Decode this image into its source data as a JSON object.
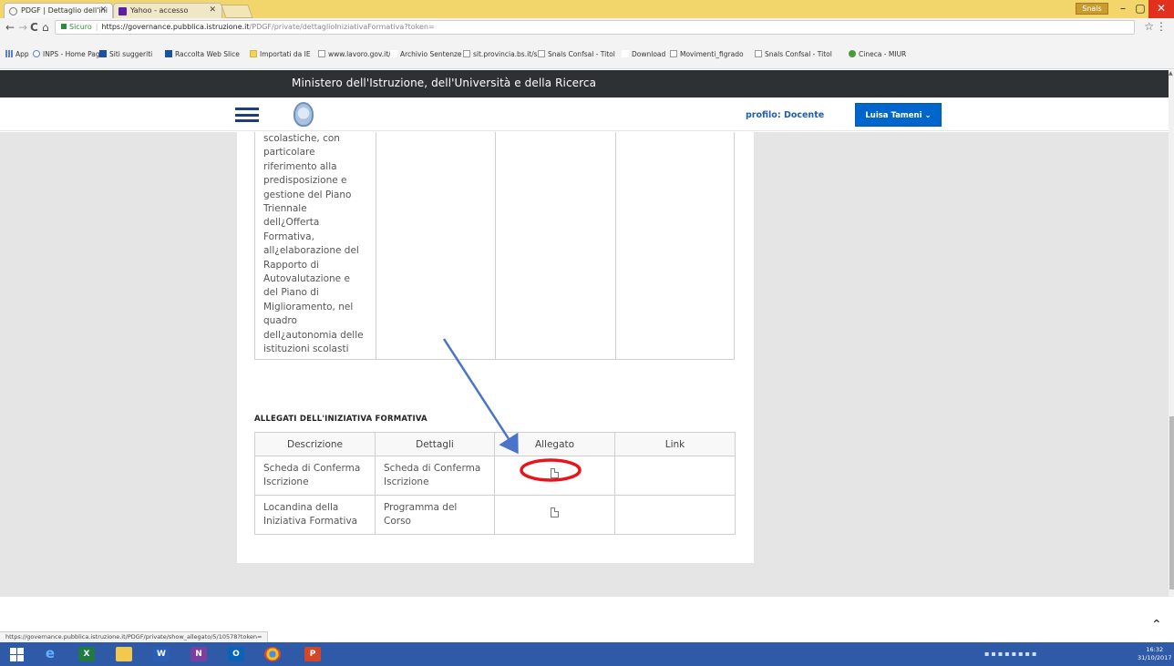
{
  "browser": {
    "tabs": [
      {
        "title": "PDGF | Dettaglio dell'ini"
      },
      {
        "title": "Yahoo - accesso"
      }
    ],
    "user_chip": "Snals",
    "window_controls": {
      "minimize": "–",
      "maximize": "▢",
      "close": "✕"
    },
    "nav": {
      "back": "←",
      "forward": "→",
      "reload": "C",
      "home": "⌂"
    },
    "address": {
      "secure_label": "Sicuro",
      "url_host": "https://governance.pubblica.istruzione.it",
      "url_path": "/PDGF/private/dettaglioIniziativaFormativa?token="
    },
    "bookmarks": [
      {
        "label": "App",
        "icon": "apps-grid-icon"
      },
      {
        "label": "INPS - Home Page",
        "icon": "inps-icon"
      },
      {
        "label": "Siti suggeriti",
        "icon": "bing-icon"
      },
      {
        "label": "Raccolta Web Slice",
        "icon": "bing-icon"
      },
      {
        "label": "Importati da IE",
        "icon": "folder-icon"
      },
      {
        "label": "www.lavoro.gov.it/f",
        "icon": "page-icon"
      },
      {
        "label": "Archivio Sentenze e",
        "icon": "ga-icon"
      },
      {
        "label": "sit.provincia.bs.it/sit",
        "icon": "page-icon"
      },
      {
        "label": "Snals Confsal - Titol",
        "icon": "page-icon"
      },
      {
        "label": "Download",
        "icon": "download-icon"
      },
      {
        "label": "Movimenti_figrado",
        "icon": "page-icon"
      },
      {
        "label": "Snals Confsal - Titol",
        "icon": "page-icon"
      },
      {
        "label": "Cineca - MIUR",
        "icon": "cineca-icon"
      }
    ],
    "status_url": "https://governance.pubblica.istruzione.it/PDGF/private/show_allegato/5/10578?token="
  },
  "site": {
    "ministry_title": "Ministero dell'Istruzione, dell'Università e della Ricerca",
    "profile_label": "profilo: Docente",
    "user_button": "Luisa Tameni"
  },
  "content": {
    "long_text": "scolastiche, con\nparticolare\nriferimento alla\npredisposizione e\ngestione del Piano\nTriennale\ndell¿Offerta\nFormativa,\nall¿elaborazione del\nRapporto di\nAutovalutazione e\ndel Piano di\nMiglioramento, nel\nquadro\ndell¿autonomia delle\nistituzioni scolasti",
    "section_title": "ALLEGATI DELL'INIZIATIVA FORMATIVA",
    "table": {
      "headers": [
        "Descrizione",
        "Dettagli",
        "Allegato",
        "Link"
      ],
      "rows": [
        {
          "descrizione": "Scheda di Conferma Iscrizione",
          "dettagli": "Scheda di Conferma Iscrizione",
          "allegato_icon": "document-icon",
          "link": ""
        },
        {
          "descrizione": "Locandina della Iniziativa Formativa",
          "dettagli": "Programma del Corso",
          "allegato_icon": "document-icon",
          "link": ""
        }
      ]
    }
  },
  "annotation": {
    "arrow_color": "#4a74c9",
    "circle_color": "#e8141b"
  },
  "taskbar": {
    "apps": [
      "start-icon",
      "internet-explorer-icon",
      "excel-icon",
      "file-explorer-icon",
      "word-icon",
      "onenote-icon",
      "outlook-icon",
      "chrome-icon",
      "powerpoint-icon"
    ],
    "clock_time": "16:32",
    "clock_date": "31/10/2017"
  }
}
